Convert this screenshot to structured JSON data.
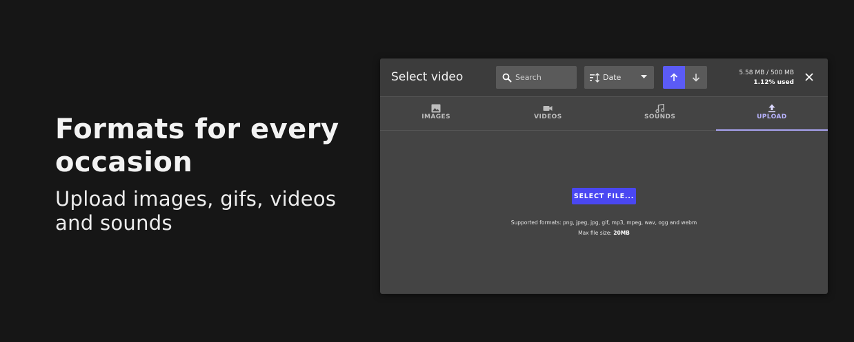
{
  "hero": {
    "title": "Formats for every occasion",
    "subtitle": "Upload images, gifs, videos and sounds"
  },
  "modal": {
    "title": "Select video",
    "search": {
      "placeholder": "Search",
      "icon": "search-icon"
    },
    "sort": {
      "label": "Date",
      "icon": "sort-icon"
    },
    "direction": {
      "up_icon": "arrow-up-icon",
      "down_icon": "arrow-down-icon",
      "active": "up"
    },
    "storage": {
      "usage": "5.58 MB / 500 MB",
      "percent": "1.12% used"
    },
    "close_icon": "close-icon",
    "tabs": [
      {
        "label": "IMAGES",
        "icon": "image-icon",
        "active": false
      },
      {
        "label": "VIDEOS",
        "icon": "video-icon",
        "active": false
      },
      {
        "label": "SOUNDS",
        "icon": "music-note-icon",
        "active": false
      },
      {
        "label": "UPLOAD",
        "icon": "upload-icon",
        "active": true
      }
    ],
    "upload": {
      "button_label": "SELECT FILE...",
      "supported_formats": "Supported formats: png, jpeg, jpg, gif, mp3, mpeg, wav, ogg and webm",
      "max_size_label": "Max file size: ",
      "max_size_value": "20MB"
    }
  },
  "colors": {
    "page_background": "#161616",
    "modal_background": "#444444",
    "accent": "#5b5bf5",
    "active_tab": "#b9b4ff"
  }
}
